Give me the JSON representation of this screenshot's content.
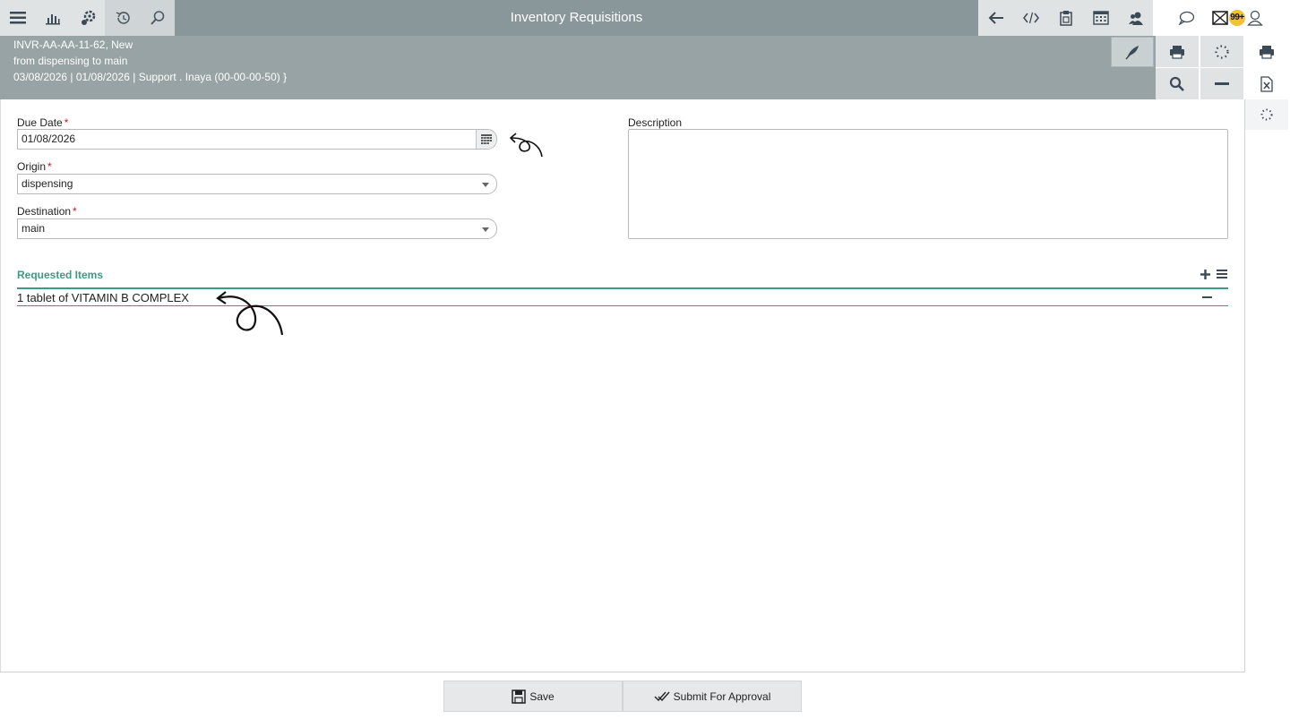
{
  "app": {
    "title": "Inventory Requisitions"
  },
  "toolbar_left": [
    "menu-icon",
    "chart-icon",
    "settings-icon",
    "history-icon",
    "search-icon"
  ],
  "toolbar_right": [
    "back-arrow-icon",
    "code-icon",
    "clipboard-icon",
    "calendar-grid-icon",
    "users-icon"
  ],
  "user_area": {
    "notifications_badge": "99+"
  },
  "header": {
    "line1": "INVR-AA-AA-11-62, New",
    "line2": "from dispensing to main",
    "line3": "03/08/2026 | 01/08/2026 | Support . Inaya (00-00-00-50) }"
  },
  "form": {
    "due_date": {
      "label": "Due Date",
      "required_mark": "*",
      "value": "01/08/2026"
    },
    "origin": {
      "label": "Origin",
      "required_mark": "*",
      "value": "dispensing"
    },
    "destination": {
      "label": "Destination",
      "required_mark": "*",
      "value": "main"
    },
    "description": {
      "label": "Description",
      "value": ""
    }
  },
  "requested_items": {
    "title": "Requested Items",
    "items": [
      "1 tablet of VITAMIN B COMPLEX"
    ]
  },
  "buttons": {
    "save": "Save",
    "submit": "Submit For Approval"
  },
  "colors": {
    "accent": "#3d9a84",
    "topbar": "#89979b",
    "header": "#97a3a5",
    "required": "#d11111",
    "badge": "#f2c230"
  }
}
